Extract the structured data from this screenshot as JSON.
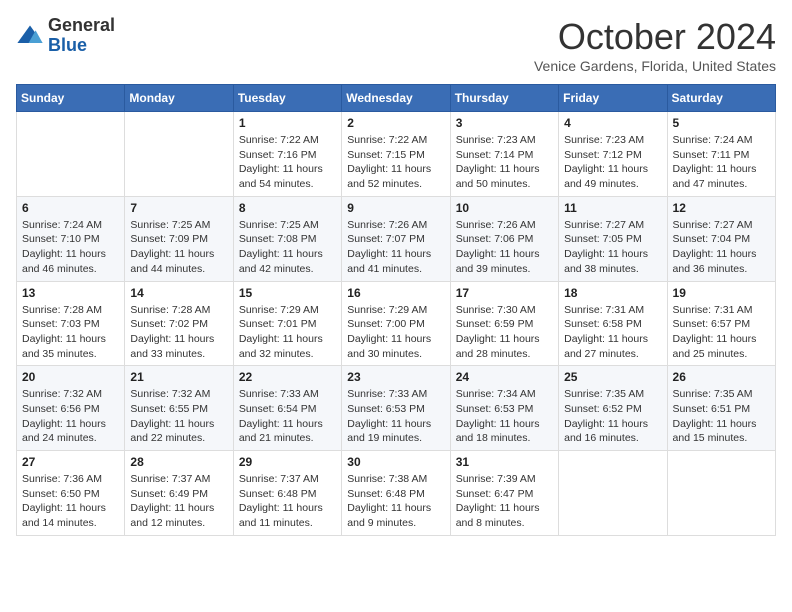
{
  "header": {
    "logo_line1": "General",
    "logo_line2": "Blue",
    "month_title": "October 2024",
    "location": "Venice Gardens, Florida, United States"
  },
  "days_of_week": [
    "Sunday",
    "Monday",
    "Tuesday",
    "Wednesday",
    "Thursday",
    "Friday",
    "Saturday"
  ],
  "weeks": [
    [
      {
        "day": "",
        "info": ""
      },
      {
        "day": "",
        "info": ""
      },
      {
        "day": "1",
        "info": "Sunrise: 7:22 AM\nSunset: 7:16 PM\nDaylight: 11 hours and 54 minutes."
      },
      {
        "day": "2",
        "info": "Sunrise: 7:22 AM\nSunset: 7:15 PM\nDaylight: 11 hours and 52 minutes."
      },
      {
        "day": "3",
        "info": "Sunrise: 7:23 AM\nSunset: 7:14 PM\nDaylight: 11 hours and 50 minutes."
      },
      {
        "day": "4",
        "info": "Sunrise: 7:23 AM\nSunset: 7:12 PM\nDaylight: 11 hours and 49 minutes."
      },
      {
        "day": "5",
        "info": "Sunrise: 7:24 AM\nSunset: 7:11 PM\nDaylight: 11 hours and 47 minutes."
      }
    ],
    [
      {
        "day": "6",
        "info": "Sunrise: 7:24 AM\nSunset: 7:10 PM\nDaylight: 11 hours and 46 minutes."
      },
      {
        "day": "7",
        "info": "Sunrise: 7:25 AM\nSunset: 7:09 PM\nDaylight: 11 hours and 44 minutes."
      },
      {
        "day": "8",
        "info": "Sunrise: 7:25 AM\nSunset: 7:08 PM\nDaylight: 11 hours and 42 minutes."
      },
      {
        "day": "9",
        "info": "Sunrise: 7:26 AM\nSunset: 7:07 PM\nDaylight: 11 hours and 41 minutes."
      },
      {
        "day": "10",
        "info": "Sunrise: 7:26 AM\nSunset: 7:06 PM\nDaylight: 11 hours and 39 minutes."
      },
      {
        "day": "11",
        "info": "Sunrise: 7:27 AM\nSunset: 7:05 PM\nDaylight: 11 hours and 38 minutes."
      },
      {
        "day": "12",
        "info": "Sunrise: 7:27 AM\nSunset: 7:04 PM\nDaylight: 11 hours and 36 minutes."
      }
    ],
    [
      {
        "day": "13",
        "info": "Sunrise: 7:28 AM\nSunset: 7:03 PM\nDaylight: 11 hours and 35 minutes."
      },
      {
        "day": "14",
        "info": "Sunrise: 7:28 AM\nSunset: 7:02 PM\nDaylight: 11 hours and 33 minutes."
      },
      {
        "day": "15",
        "info": "Sunrise: 7:29 AM\nSunset: 7:01 PM\nDaylight: 11 hours and 32 minutes."
      },
      {
        "day": "16",
        "info": "Sunrise: 7:29 AM\nSunset: 7:00 PM\nDaylight: 11 hours and 30 minutes."
      },
      {
        "day": "17",
        "info": "Sunrise: 7:30 AM\nSunset: 6:59 PM\nDaylight: 11 hours and 28 minutes."
      },
      {
        "day": "18",
        "info": "Sunrise: 7:31 AM\nSunset: 6:58 PM\nDaylight: 11 hours and 27 minutes."
      },
      {
        "day": "19",
        "info": "Sunrise: 7:31 AM\nSunset: 6:57 PM\nDaylight: 11 hours and 25 minutes."
      }
    ],
    [
      {
        "day": "20",
        "info": "Sunrise: 7:32 AM\nSunset: 6:56 PM\nDaylight: 11 hours and 24 minutes."
      },
      {
        "day": "21",
        "info": "Sunrise: 7:32 AM\nSunset: 6:55 PM\nDaylight: 11 hours and 22 minutes."
      },
      {
        "day": "22",
        "info": "Sunrise: 7:33 AM\nSunset: 6:54 PM\nDaylight: 11 hours and 21 minutes."
      },
      {
        "day": "23",
        "info": "Sunrise: 7:33 AM\nSunset: 6:53 PM\nDaylight: 11 hours and 19 minutes."
      },
      {
        "day": "24",
        "info": "Sunrise: 7:34 AM\nSunset: 6:53 PM\nDaylight: 11 hours and 18 minutes."
      },
      {
        "day": "25",
        "info": "Sunrise: 7:35 AM\nSunset: 6:52 PM\nDaylight: 11 hours and 16 minutes."
      },
      {
        "day": "26",
        "info": "Sunrise: 7:35 AM\nSunset: 6:51 PM\nDaylight: 11 hours and 15 minutes."
      }
    ],
    [
      {
        "day": "27",
        "info": "Sunrise: 7:36 AM\nSunset: 6:50 PM\nDaylight: 11 hours and 14 minutes."
      },
      {
        "day": "28",
        "info": "Sunrise: 7:37 AM\nSunset: 6:49 PM\nDaylight: 11 hours and 12 minutes."
      },
      {
        "day": "29",
        "info": "Sunrise: 7:37 AM\nSunset: 6:48 PM\nDaylight: 11 hours and 11 minutes."
      },
      {
        "day": "30",
        "info": "Sunrise: 7:38 AM\nSunset: 6:48 PM\nDaylight: 11 hours and 9 minutes."
      },
      {
        "day": "31",
        "info": "Sunrise: 7:39 AM\nSunset: 6:47 PM\nDaylight: 11 hours and 8 minutes."
      },
      {
        "day": "",
        "info": ""
      },
      {
        "day": "",
        "info": ""
      }
    ]
  ]
}
